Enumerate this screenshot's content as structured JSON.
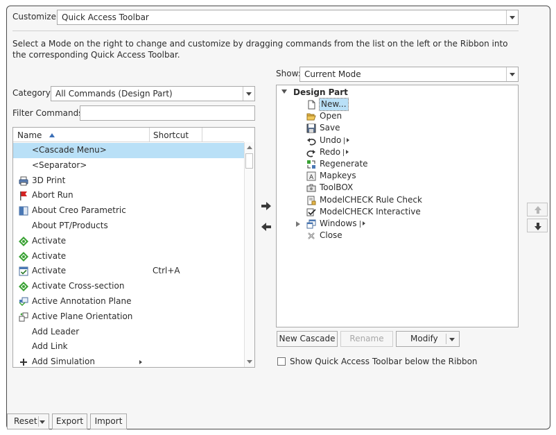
{
  "customize": {
    "label": "Customize:",
    "value": "Quick Access Toolbar"
  },
  "description": "Select a Mode on the right to change and customize by dragging commands from the list on the left or the Ribbon into the corresponding Quick Access Toolbar.",
  "category": {
    "label": "Category:",
    "value": "All Commands (Design Part)"
  },
  "filter": {
    "label": "Filter Commands:",
    "value": ""
  },
  "show": {
    "label": "Show:",
    "value": "Current Mode"
  },
  "commands_list": {
    "columns": [
      "Name",
      "Shortcut"
    ],
    "rows": [
      {
        "name": "<Cascade Menu>",
        "shortcut": "",
        "icon": "none",
        "selected": true
      },
      {
        "name": "<Separator>",
        "shortcut": "",
        "icon": "none"
      },
      {
        "name": "3D Print",
        "shortcut": "",
        "icon": "printer-icon"
      },
      {
        "name": "Abort Run",
        "shortcut": "",
        "icon": "red-flag-icon"
      },
      {
        "name": "About Creo Parametric",
        "shortcut": "",
        "icon": "info-window-icon"
      },
      {
        "name": "About PT/Products",
        "shortcut": "",
        "icon": "none"
      },
      {
        "name": "Activate",
        "shortcut": "",
        "icon": "green-diamond-icon"
      },
      {
        "name": "Activate",
        "shortcut": "",
        "icon": "green-diamond-icon"
      },
      {
        "name": "Activate",
        "shortcut": "Ctrl+A",
        "icon": "checked-window-icon"
      },
      {
        "name": "Activate Cross-section",
        "shortcut": "",
        "icon": "green-diamond-icon"
      },
      {
        "name": "Active Annotation Plane",
        "shortcut": "",
        "icon": "annotation-plane-icon"
      },
      {
        "name": "Active Plane Orientation",
        "shortcut": "",
        "icon": "plane-orientation-icon"
      },
      {
        "name": "Add Leader",
        "shortcut": "",
        "icon": "none"
      },
      {
        "name": "Add Link",
        "shortcut": "",
        "icon": "none"
      },
      {
        "name": "Add Simulation",
        "shortcut": "",
        "icon": "plus-icon",
        "submenu": true
      }
    ]
  },
  "toolbar_tree": {
    "root": "Design Part",
    "items": [
      {
        "label": "New...",
        "icon": "new-document-icon",
        "selected": true
      },
      {
        "label": "Open",
        "icon": "open-folder-icon"
      },
      {
        "label": "Save",
        "icon": "save-disk-icon"
      },
      {
        "label": "Undo",
        "icon": "undo-icon",
        "split": true
      },
      {
        "label": "Redo",
        "icon": "redo-icon",
        "split": true
      },
      {
        "label": "Regenerate",
        "icon": "regenerate-icon"
      },
      {
        "label": "Mapkeys",
        "icon": "mapkeys-icon"
      },
      {
        "label": "ToolBOX",
        "icon": "toolbox-icon"
      },
      {
        "label": "ModelCHECK Rule Check",
        "icon": "rule-check-icon"
      },
      {
        "label": "ModelCHECK Interactive",
        "icon": "interactive-check-icon"
      },
      {
        "label": "Windows",
        "icon": "windows-icon",
        "expandable": true,
        "split": true
      },
      {
        "label": "Close",
        "icon": "close-x-icon"
      }
    ]
  },
  "buttons": {
    "new_cascade": "New Cascade",
    "rename": "Rename",
    "modify": "Modify",
    "reset": "Reset",
    "export": "Export",
    "import": "Import"
  },
  "show_below_ribbon": {
    "label": "Show Quick Access Toolbar below the Ribbon",
    "checked": false
  }
}
